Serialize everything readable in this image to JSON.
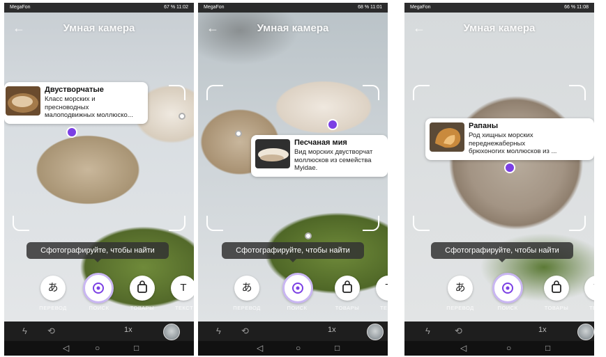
{
  "app": {
    "title": "Умная камера",
    "hint": "Сфотографируйте, чтобы найти",
    "modes": [
      "ПЕРЕВОД",
      "ПОИСК",
      "ТОВАРЫ",
      "ТЕКСТ"
    ],
    "zoom": "1x",
    "accent": "#7b3fe4"
  },
  "screens": [
    {
      "status_left": "MegaFon",
      "status_right": "67 % 11:02",
      "card": {
        "name": "Двустворчатые",
        "desc1": "Класс морских и",
        "desc2": "пресноводных",
        "desc3": "малоподвижных моллюско..."
      }
    },
    {
      "status_left": "MegaFon",
      "status_right": "68 % 11:01",
      "card": {
        "name": "Песчаная мия",
        "desc1": "Вид морских двустворчат",
        "desc2": "моллюсков из семейства",
        "desc3": "Myidae."
      }
    },
    {
      "status_left": "MegaFon",
      "status_right": "66 % 11:08",
      "card": {
        "name": "Рапаны",
        "desc1": "Род хищных морских",
        "desc2": "переднежаберных",
        "desc3": "брюхоногих моллюсков из ..."
      }
    }
  ]
}
